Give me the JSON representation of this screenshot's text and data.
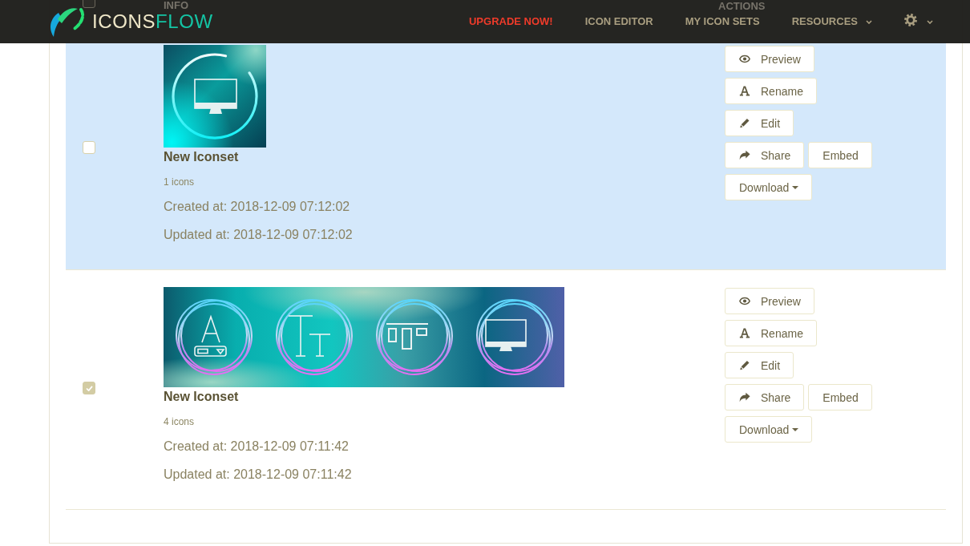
{
  "navbar": {
    "logo": {
      "parts": [
        "ICONS",
        "FLOW"
      ]
    },
    "links": [
      {
        "label": "UPGRADE NOW!",
        "kind": "promo"
      },
      {
        "label": "ICON EDITOR",
        "kind": "link"
      },
      {
        "label": "MY ICON SETS",
        "kind": "link"
      },
      {
        "label": "RESOURCES",
        "kind": "dropdown"
      },
      {
        "kind": "settings"
      }
    ]
  },
  "table": {
    "header": {
      "select_all_checked": false,
      "columns": [
        "INFO",
        "ACTIONS"
      ]
    },
    "rows": [
      {
        "highlighted": true,
        "checked": false,
        "title": "New Iconset",
        "count": "1 icons",
        "created": "Created at: 2018-12-09 07:12:02",
        "updated": "Updated at: 2018-12-09 07:12:02",
        "action_lines": [
          [
            {
              "label": "Preview",
              "kind": "preview"
            }
          ],
          [
            {
              "label": "Rename",
              "kind": "rename"
            }
          ],
          [
            {
              "label": "Edit",
              "kind": "edit"
            }
          ],
          [
            {
              "label": "Share",
              "kind": "share"
            },
            {
              "label": "Embed",
              "kind": "embed"
            }
          ],
          [
            {
              "label": "Download",
              "kind": "download"
            }
          ]
        ]
      },
      {
        "highlighted": false,
        "checked": true,
        "title": "New Iconset",
        "count": "4 icons",
        "created": "Created at: 2018-12-09 07:11:42",
        "updated": "Updated at: 2018-12-09 07:11:42",
        "action_lines": [
          [
            {
              "label": "Preview",
              "kind": "preview"
            }
          ],
          [
            {
              "label": "Rename",
              "kind": "rename"
            }
          ],
          [
            {
              "label": "Edit",
              "kind": "edit"
            }
          ],
          [
            {
              "label": "Share",
              "kind": "share"
            },
            {
              "label": "Embed",
              "kind": "embed"
            }
          ],
          [
            {
              "label": "Download",
              "kind": "download"
            }
          ]
        ]
      }
    ]
  }
}
